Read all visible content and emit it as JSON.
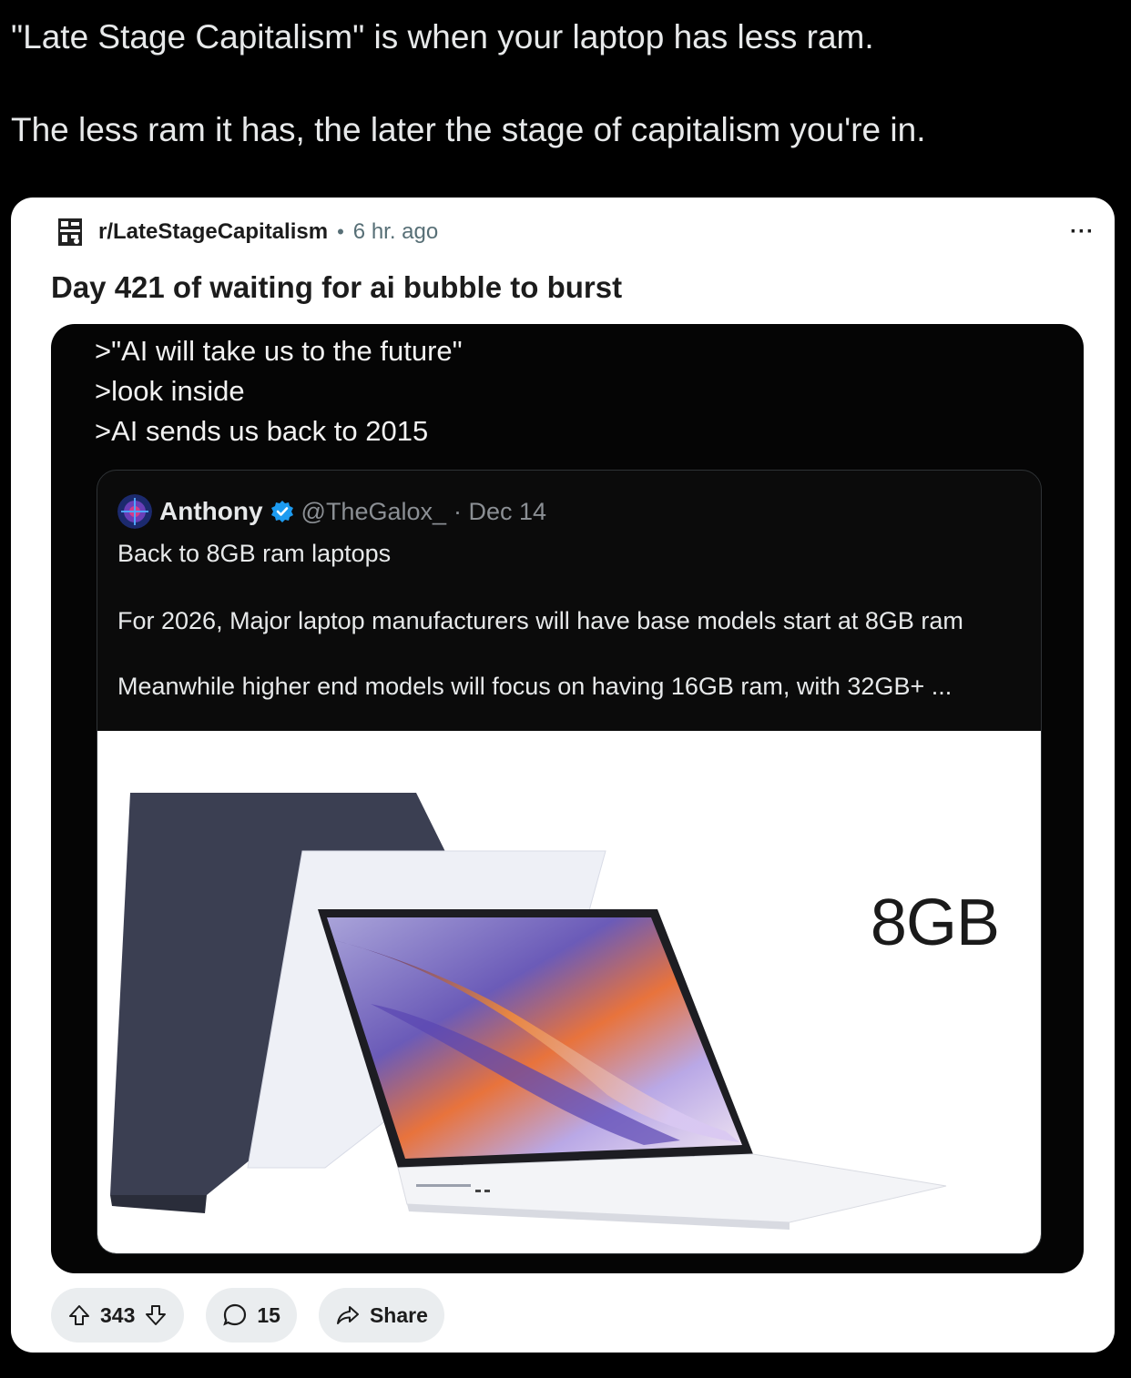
{
  "tweet": {
    "line1": "\"Late Stage Capitalism\" is when your laptop has less ram.",
    "line2": "The less ram it has, the later the stage of capitalism you're in."
  },
  "post": {
    "subreddit": "r/LateStageCapitalism",
    "separator": "•",
    "time": "6 hr. ago",
    "more": "···",
    "title": "Day 421 of waiting for ai bubble to burst",
    "greentext": [
      ">\"AI will take us to the future\"",
      ">look inside",
      ">AI sends us back to 2015"
    ],
    "embedded_tweet": {
      "name": "Anthony",
      "handle": "@TheGalox_",
      "date": "· Dec 14",
      "lines": [
        "Back to 8GB ram laptops",
        "For 2026, Major laptop manufacturers will have base models start at 8GB ram",
        "Meanwhile higher end models will focus on having 16GB ram, with 32GB+ ..."
      ],
      "image_label": "8GB"
    },
    "actions": {
      "votes": "343",
      "comments": "15",
      "share": "Share"
    }
  },
  "colors": {
    "page_bg": "#000000",
    "card_bg": "#ffffff",
    "pill_bg": "#eaedef",
    "verified": "#1d9bf0"
  }
}
